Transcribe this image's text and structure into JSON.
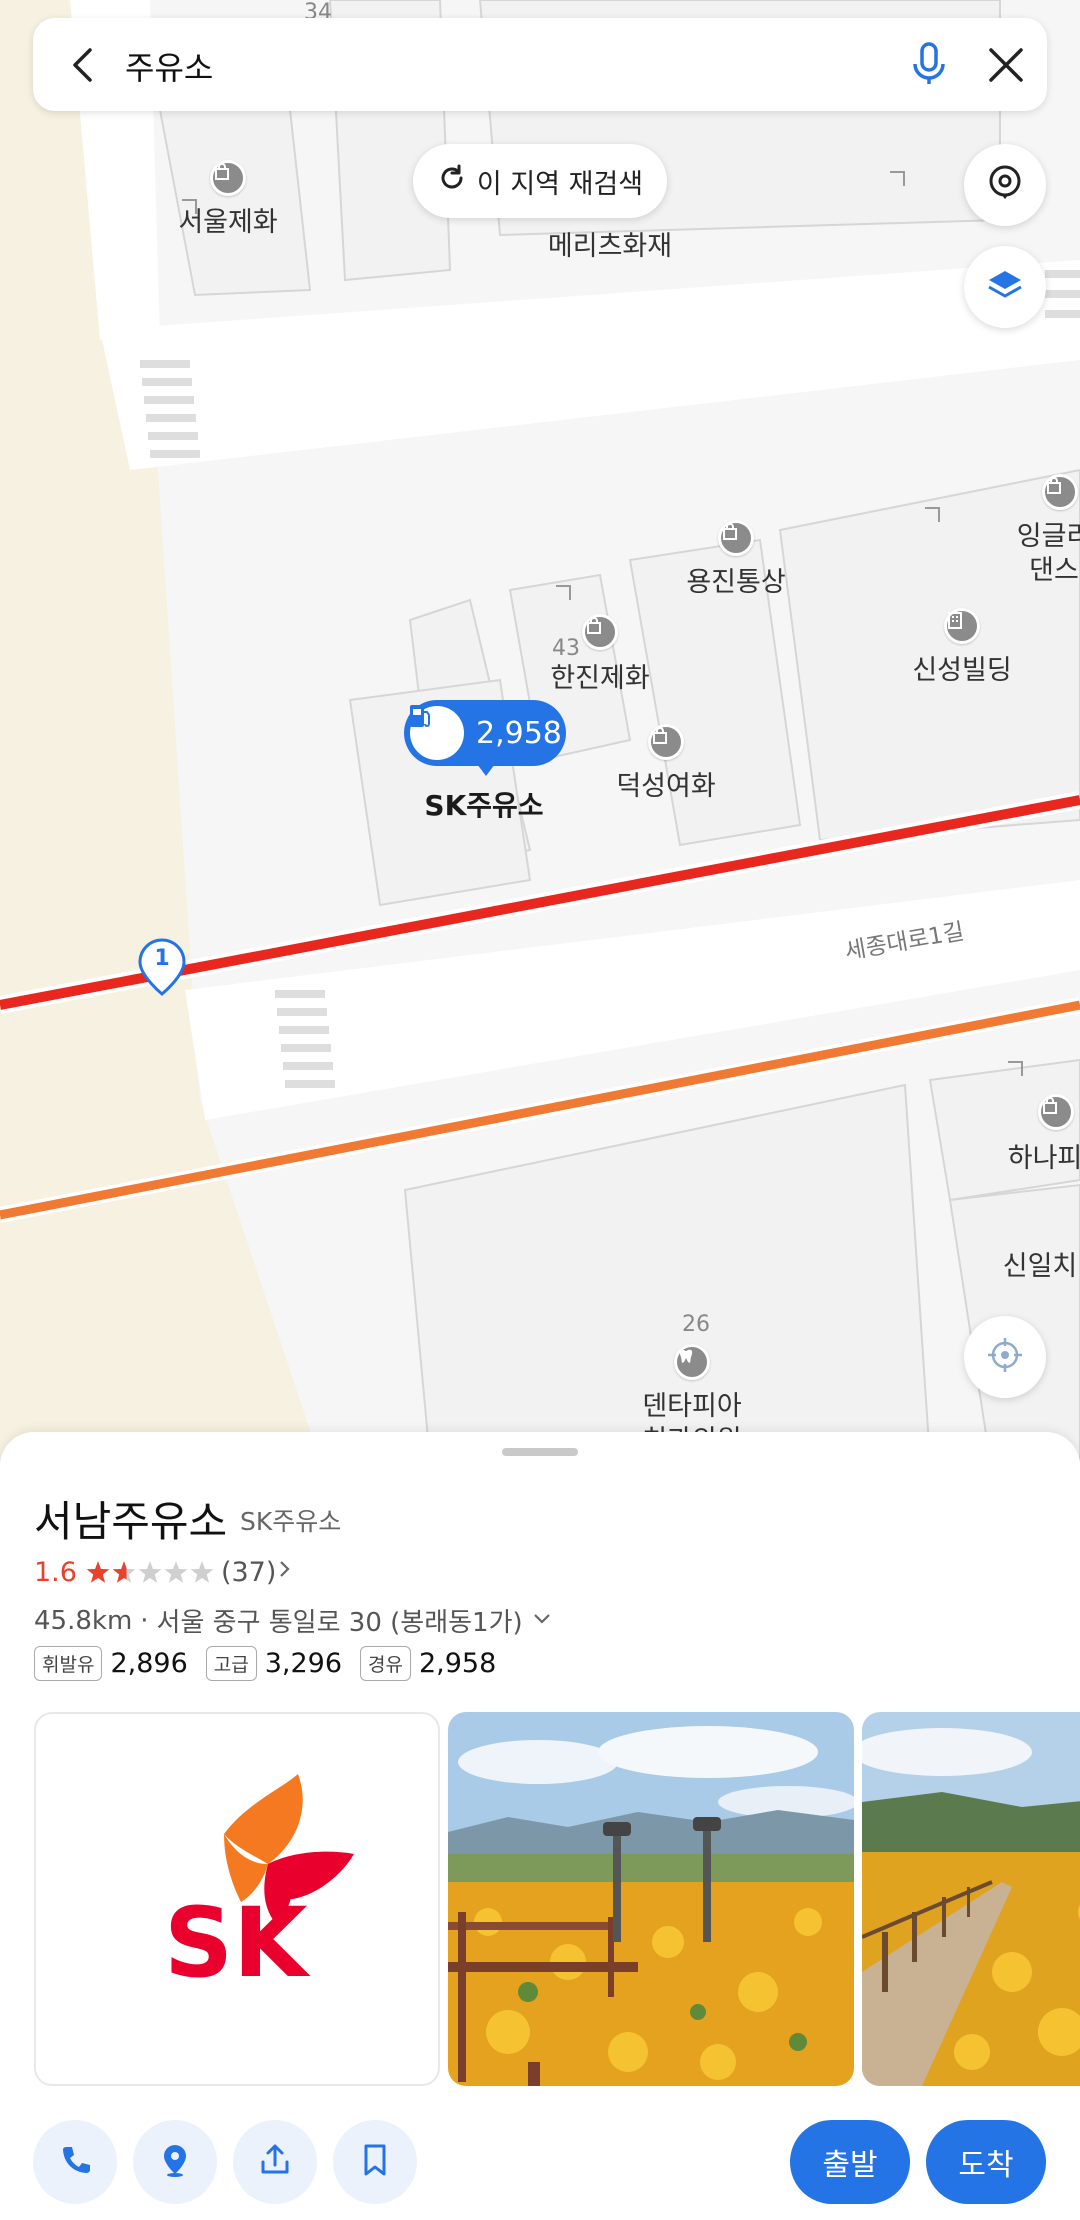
{
  "search": {
    "query": "주유소"
  },
  "map": {
    "research_label": "이 지역 재검색",
    "labels": {
      "seoul_jehwa": "서울제화",
      "meritz": "메리츠화재",
      "english_dance_1": "잉글리",
      "english_dance_2": "댄스",
      "yongjin": "용진통상",
      "hanjin": "한진제화",
      "sinseong": "신성빌딩",
      "deokseong": "덕성여화",
      "sk_station": "SK주유소",
      "road": "세종대로1길",
      "hana": "하나피",
      "sinil": "신일치",
      "dentapia_1": "덴타피아",
      "dentapia_2": "치과의원",
      "num_34": "34",
      "num_43": "43",
      "num_26": "26",
      "route_marker": "1"
    },
    "price_marker": "2,958"
  },
  "place": {
    "name": "서남주유소",
    "brand": "SK주유소",
    "rating": "1.6",
    "rating_value": 1.6,
    "review_count": "(37)",
    "distance": "45.8km",
    "separator": "·",
    "address": "서울 중구 통일로 30 (봉래동1가)",
    "fuel": [
      {
        "type": "휘발유",
        "price": "2,896"
      },
      {
        "type": "고급",
        "price": "3,296"
      },
      {
        "type": "경유",
        "price": "2,958"
      }
    ],
    "logo_text": "SK"
  },
  "actions": {
    "depart_label": "출발",
    "arrive_label": "도착"
  },
  "colors": {
    "accent": "#2574e6",
    "rating": "#e8412c",
    "route_red": "#e8271e",
    "route_orange": "#f07a34",
    "map_base": "#f6f6f6",
    "map_sand": "#f6f1e0"
  },
  "icons": {
    "back": "chevron-left-icon",
    "mic": "microphone-icon",
    "close": "close-icon",
    "refresh": "refresh-icon",
    "location_pin": "location-pin-icon",
    "layers": "layers-icon",
    "my_location": "crosshair-icon",
    "fuel": "fuel-pump-icon",
    "phone": "phone-icon",
    "place_pin": "place-pin-icon",
    "share": "share-icon",
    "bookmark": "bookmark-icon"
  }
}
